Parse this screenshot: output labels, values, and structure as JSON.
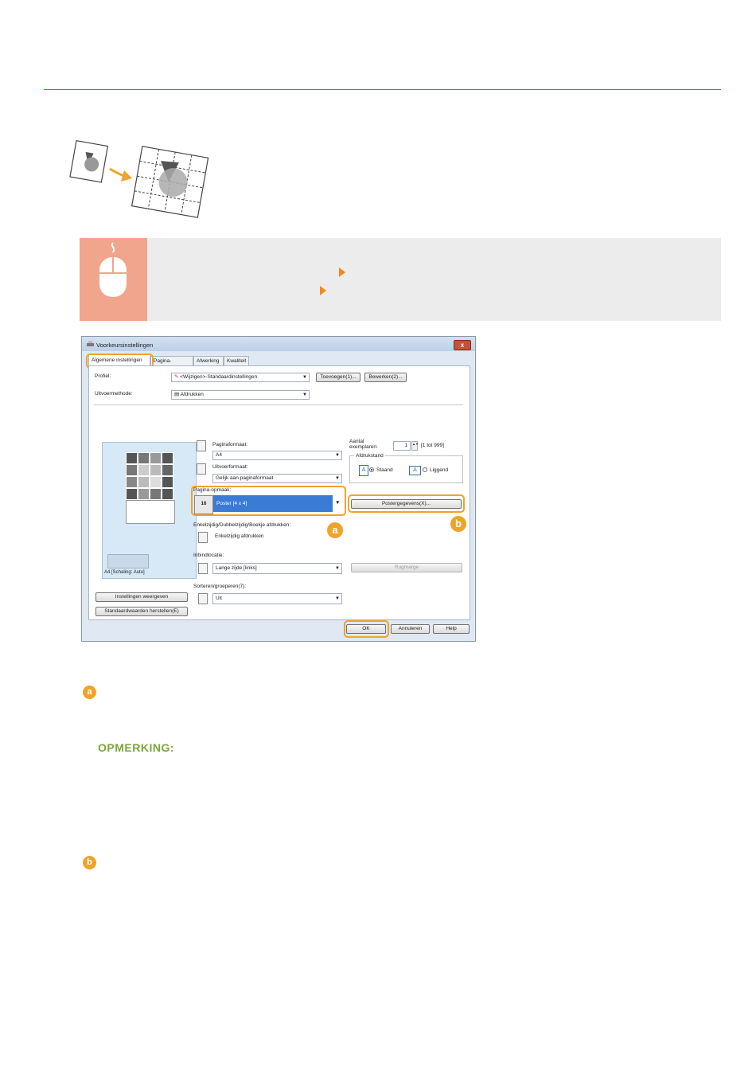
{
  "dialog": {
    "title": "Voorkeursinstellingen",
    "close": "x",
    "tabs": [
      "Algemene instellingen",
      "Pagina-instelling",
      "Afwerking",
      "Kwaliteit"
    ],
    "profile_label": "Profiel:",
    "profile_value": "<Wijzigen>-Standaardinstellingen",
    "add_button": "Toevoegen(1)...",
    "edit_button": "Bewerken(2)...",
    "output_label": "Uitvoermethode:",
    "output_value": "Afdrukken",
    "page_size_label": "Paginaformaat:",
    "page_size_value": "A4",
    "output_size_label": "Uitvoerformaat:",
    "output_size_value": "Gelijk aan paginaformaat",
    "copies_label": "Aantal exemplaren:",
    "copies_value": "1",
    "copies_range": "[1 tot 999]",
    "orientation_label": "Afdrukstand",
    "portrait": "Staand",
    "landscape": "Liggend",
    "layout_label": "Pagina-opmaak:",
    "layout_value": "Poster [4 x 4]",
    "layout_icon_text": "16",
    "poster_details_button": "Postergegevens(X)...",
    "duplex_label": "Enkelzijdig/Dubbelzijdig/Boekje afdrukken:",
    "duplex_value": "Enkelzijdig afdrukken",
    "binding_label": "Inbindlocatie:",
    "binding_value": "Lange zijde [links]",
    "gutter_button": "Rugmarge",
    "collate_label": "Sorteren/groeperen(7):",
    "collate_value": "Uit",
    "preview_caption": "A4 [Schaling: Auto]",
    "view_settings_button": "Instellingen weergeven",
    "restore_defaults_button": "Standaardwaarden herstellen(E)",
    "ok_button": "OK",
    "cancel_button": "Annuleren",
    "help_button": "Help"
  },
  "callouts": {
    "a": "a",
    "b": "b"
  },
  "note_heading": "OPMERKING:",
  "colors": {
    "accent_orange": "#f0a32a",
    "rule_red": "#c9542e",
    "note_green": "#7aa63a",
    "banner_gray": "#ececec",
    "mouse_salmon": "#f0a58c"
  }
}
